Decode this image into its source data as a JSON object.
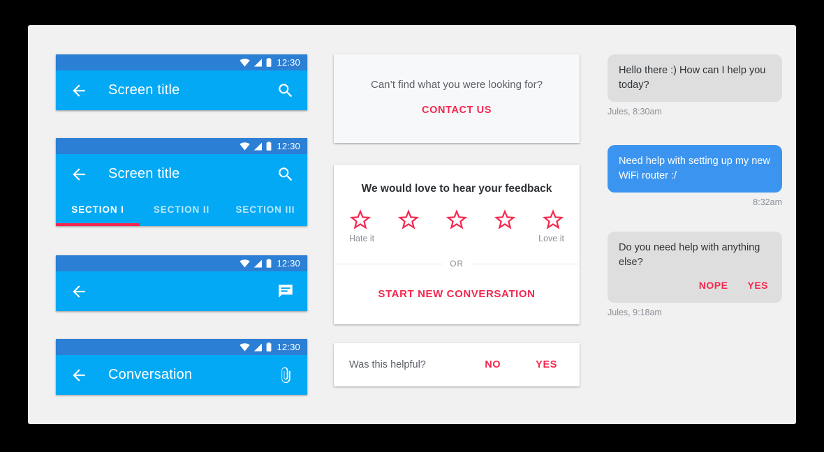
{
  "theme": {
    "status_bar_color": "#2b7fd4",
    "app_bar_color": "#03a9f4",
    "accent_red": "#f5274e",
    "bubble_gray": "#dedede",
    "bubble_blue": "#3b95f0",
    "panel_bg": "#f1f1f1",
    "page_bg": "#000000"
  },
  "status_bar": {
    "time": "12:30",
    "icons": [
      "wifi-icon",
      "signal-icon",
      "battery-icon"
    ]
  },
  "devices": [
    {
      "id": "app-bar-basic",
      "title": "Screen title",
      "nav_icon": "back-arrow-icon",
      "action_icon": "search-icon",
      "has_tabs": false
    },
    {
      "id": "app-bar-tabs",
      "title": "Screen title",
      "nav_icon": "back-arrow-icon",
      "action_icon": "search-icon",
      "has_tabs": true,
      "tabs": [
        {
          "label": "SECTION I",
          "active": true
        },
        {
          "label": "SECTION II",
          "active": false
        },
        {
          "label": "SECTION III",
          "active": false
        }
      ]
    },
    {
      "id": "app-bar-chat",
      "title": "",
      "nav_icon": "back-arrow-icon",
      "action_icon": "chat-icon",
      "has_tabs": false
    },
    {
      "id": "app-bar-conversation",
      "title": "Conversation",
      "nav_icon": "back-arrow-icon",
      "action_icon": "attachment-icon",
      "has_tabs": false
    }
  ],
  "cards": {
    "contact": {
      "prompt": "Can’t find what you were looking for?",
      "action_label": "CONTACT US"
    },
    "feedback": {
      "title": "We would love to hear your feedback",
      "star_count": 5,
      "star_icon": "star-outline-icon",
      "low_label": "Hate it",
      "high_label": "Love it",
      "divider_label": "OR",
      "action_label": "START NEW CONVERSATION"
    },
    "helpful": {
      "question": "Was this helpful?",
      "no_label": "NO",
      "yes_label": "YES"
    }
  },
  "chat": {
    "messages": [
      {
        "id": "msg-1",
        "side": "them",
        "text": "Hello there :) How can I help you today?",
        "meta": "Jules, 8:30am",
        "actions": []
      },
      {
        "id": "msg-2",
        "side": "me",
        "text": "Need help with setting up my new WiFi router :/",
        "meta": "8:32am",
        "actions": []
      },
      {
        "id": "msg-3",
        "side": "them",
        "text": "Do you need help with anything else?",
        "meta": "Jules, 9:18am",
        "actions": [
          "NOPE",
          "YES"
        ]
      }
    ]
  }
}
